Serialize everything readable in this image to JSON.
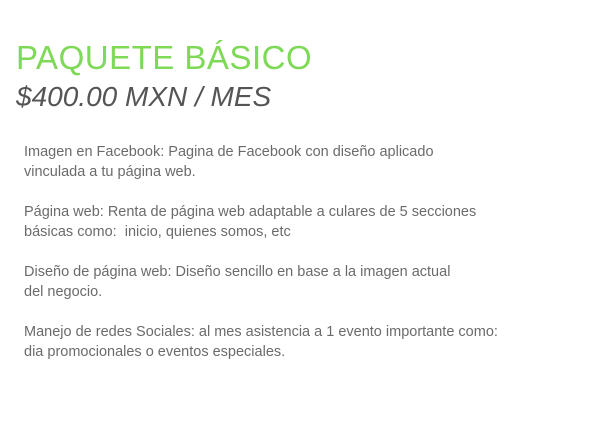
{
  "package": {
    "title": "PAQUETE BÁSICO",
    "price": "$400.00 MXN / MES"
  },
  "features": [
    {
      "lines": [
        "Imagen en Facebook: Pagina de Facebook con diseño aplicado",
        "vinculada a tu página web."
      ]
    },
    {
      "lines": [
        "Página web: Renta de página web adaptable a culares de 5 secciones",
        "básicas como:  inicio, quienes somos, etc"
      ]
    },
    {
      "lines": [
        "Diseño de página web: Diseño sencillo en base a la imagen actual",
        "del negocio."
      ]
    },
    {
      "lines": [
        "Manejo de redes Sociales: al mes asistencia a 1 evento importante como:",
        "dia promocionales o eventos especiales."
      ]
    }
  ],
  "colors": {
    "title": "#7ed957",
    "price": "#555555",
    "body_text": "#6b6b6b",
    "background": "#ffffff"
  }
}
